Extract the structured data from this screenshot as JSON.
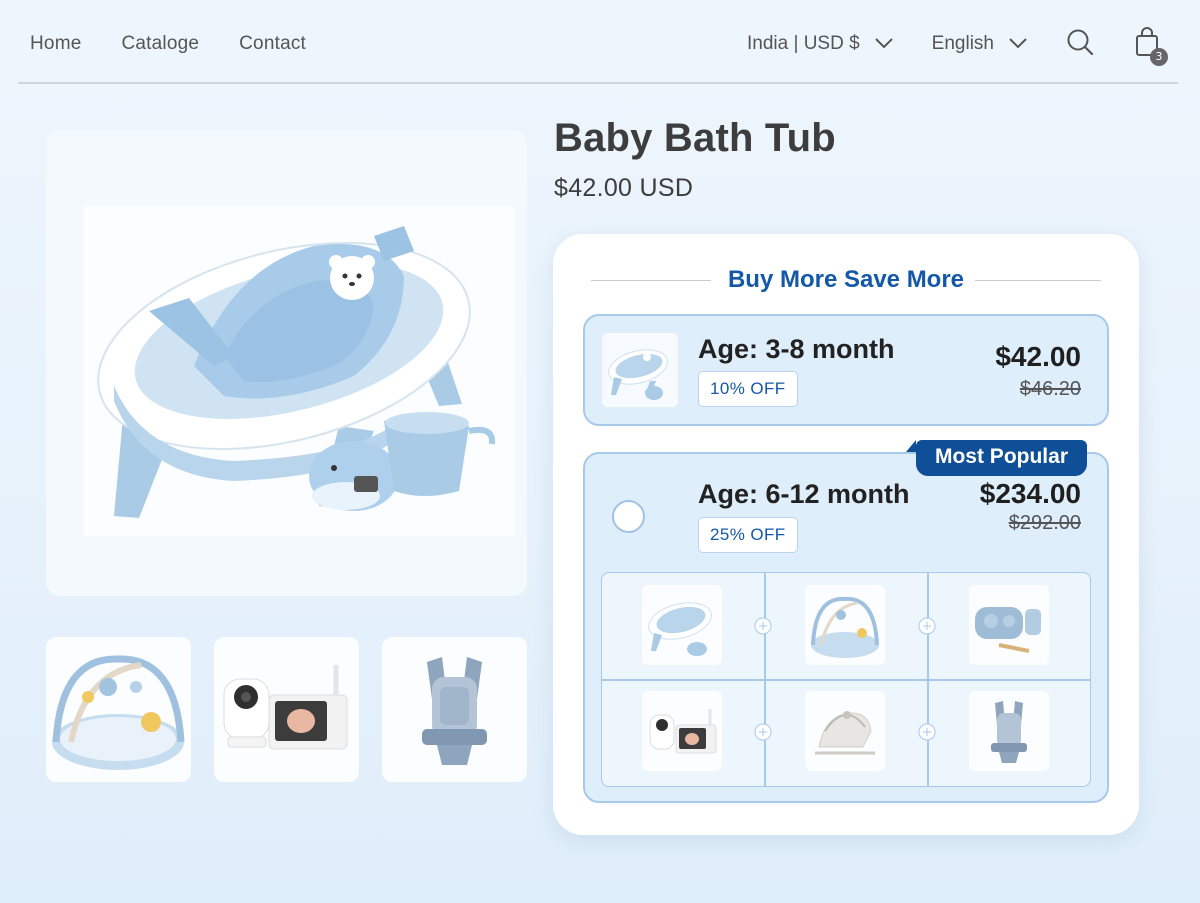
{
  "nav": {
    "home": "Home",
    "catalog": "Cataloge",
    "contact": "Contact"
  },
  "header": {
    "region": "India | USD $",
    "language": "English",
    "cart_count": "3",
    "icons": [
      "search-icon",
      "shopping-bag-icon",
      "chevron-down-icon"
    ]
  },
  "product": {
    "title": "Baby Bath Tub",
    "price": "$42.00 USD",
    "main_image": "baby-bath-tub-set",
    "thumbnails": [
      "baby-play-gym",
      "baby-video-monitor",
      "baby-carrier"
    ]
  },
  "bundle": {
    "heading": "Buy More Save More",
    "options": [
      {
        "label": "Age: 3-8 month",
        "discount": "10% OFF",
        "price": "$42.00",
        "original_price": "$46.20"
      },
      {
        "label": "Age: 6-12 month",
        "discount": "25% OFF",
        "price": "$234.00",
        "original_price": "$292.00",
        "tag": "Most Popular",
        "items": [
          "baby-bath-tub",
          "baby-play-gym",
          "baby-dinnerware-set",
          "baby-video-monitor",
          "baby-bouncer",
          "baby-carrier"
        ]
      }
    ]
  },
  "colors": {
    "accent": "#1458a8",
    "tag_bg": "#0f4f97",
    "option_bg": "#dfeefb",
    "option_border": "#a7c9ea"
  }
}
